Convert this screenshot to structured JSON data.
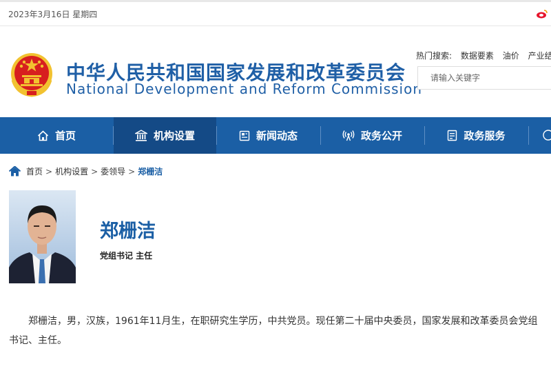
{
  "topbar": {
    "date": "2023年3月16日 星期四"
  },
  "header": {
    "title_cn": "中华人民共和国国家发展和改革委员会",
    "title_en": "National Development and Reform Commission",
    "hot_label": "热门搜索:",
    "hot_items": [
      "数据要素",
      "油价",
      "产业结"
    ],
    "search_placeholder": "请输入关键字"
  },
  "nav": {
    "items": [
      {
        "label": "首页",
        "icon": "home-icon"
      },
      {
        "label": "机构设置",
        "icon": "institution-icon"
      },
      {
        "label": "新闻动态",
        "icon": "news-icon"
      },
      {
        "label": "政务公开",
        "icon": "broadcast-icon"
      },
      {
        "label": "政务服务",
        "icon": "service-icon"
      }
    ]
  },
  "breadcrumb": {
    "items": [
      "首页",
      "机构设置",
      "委领导"
    ],
    "current": "郑栅洁"
  },
  "profile": {
    "name": "郑栅洁",
    "position": "党组书记 主任",
    "bio": "郑栅洁，男，汉族，1961年11月生，在职研究生学历，中共党员。现任第二十届中央委员，国家发展和改革委员会党组书记、主任。"
  },
  "colors": {
    "brand": "#1b5fa5",
    "nav_active": "#144a86",
    "emblem_red": "#d71f1f",
    "emblem_gold": "#f2c230"
  }
}
